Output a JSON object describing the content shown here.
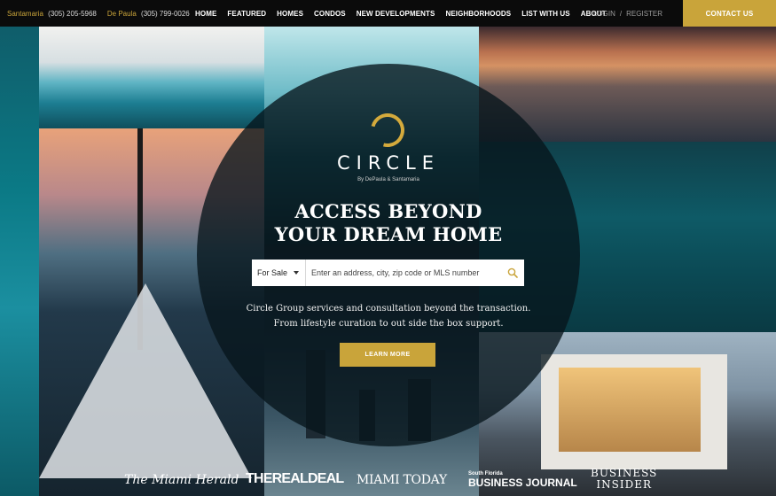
{
  "topbar": {
    "agents": [
      {
        "name": "Santamaria",
        "phone": "(305) 205-5968"
      },
      {
        "name": "De Paula",
        "phone": "(305) 799-0026"
      }
    ],
    "nav": [
      "HOME",
      "FEATURED",
      "HOMES",
      "CONDOS",
      "NEW DEVELOPMENTS",
      "NEIGHBORHOODS",
      "LIST WITH US",
      "ABOUT"
    ],
    "login": "LOGIN",
    "separator": "/",
    "register": "REGISTER",
    "contact": "CONTACT US"
  },
  "hero": {
    "brand": "CIRCLE",
    "brand_sub": "By DePaula & Santamaria",
    "headline_line1": "ACCESS BEYOND",
    "headline_line2": "YOUR DREAM HOME",
    "search": {
      "type_selected": "For Sale",
      "placeholder": "Enter an address, city, zip code or MLS number"
    },
    "tagline_line1": "Circle Group services and consultation beyond the transaction.",
    "tagline_line2": "From lifestyle curation to out side the box support.",
    "cta": "LEARN MORE"
  },
  "press": {
    "miami_herald": "The Miami Herald",
    "real_deal": "THEREALDEAL",
    "miami_today": "MIAMI TODAY",
    "sfbj_small": "South Florida",
    "sfbj": "BUSINESS JOURNAL",
    "bi_line1": "BUSINESS",
    "bi_line2": "INSIDER"
  },
  "colors": {
    "accent": "#c9a43a",
    "topbar": "#0b0b0b",
    "overlay": "#07141b"
  }
}
